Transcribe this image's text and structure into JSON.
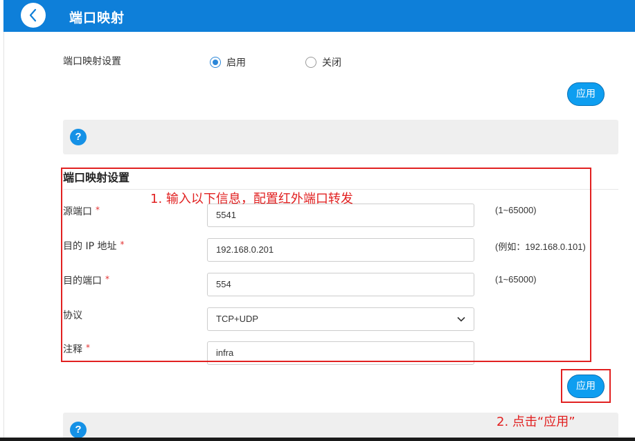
{
  "header": {
    "title": "端口映射"
  },
  "enable_section": {
    "label": "端口映射设置",
    "options": [
      {
        "label": "启用",
        "checked": true
      },
      {
        "label": "关闭",
        "checked": false
      }
    ],
    "apply_label": "应用"
  },
  "help": {
    "icon_glyph": "?"
  },
  "form": {
    "title": "端口映射设置",
    "required_mark": "*",
    "fields": {
      "src_port": {
        "label": "源端口",
        "value": "5541",
        "hint": "(1~65000)",
        "required": true
      },
      "dst_ip": {
        "label": "目的 IP 地址",
        "value": "192.168.0.201",
        "hint": "(例如：192.168.0.101)",
        "required": true
      },
      "dst_port": {
        "label": "目的端口",
        "value": "554",
        "hint": "(1~65000)",
        "required": true
      },
      "protocol": {
        "label": "协议",
        "value": "TCP+UDP",
        "required": false
      },
      "comment": {
        "label": "注释",
        "value": "infra",
        "required": true
      }
    },
    "apply_label": "应用"
  },
  "annotations": {
    "step1": "1. 输入以下信息，配置红外端口转发",
    "step2": "2. 点击“应用”"
  },
  "colors": {
    "header": "#0e7fd9",
    "button": "#0e9ef0",
    "annotation": "#e12020",
    "help_icon": "#1591e6"
  }
}
